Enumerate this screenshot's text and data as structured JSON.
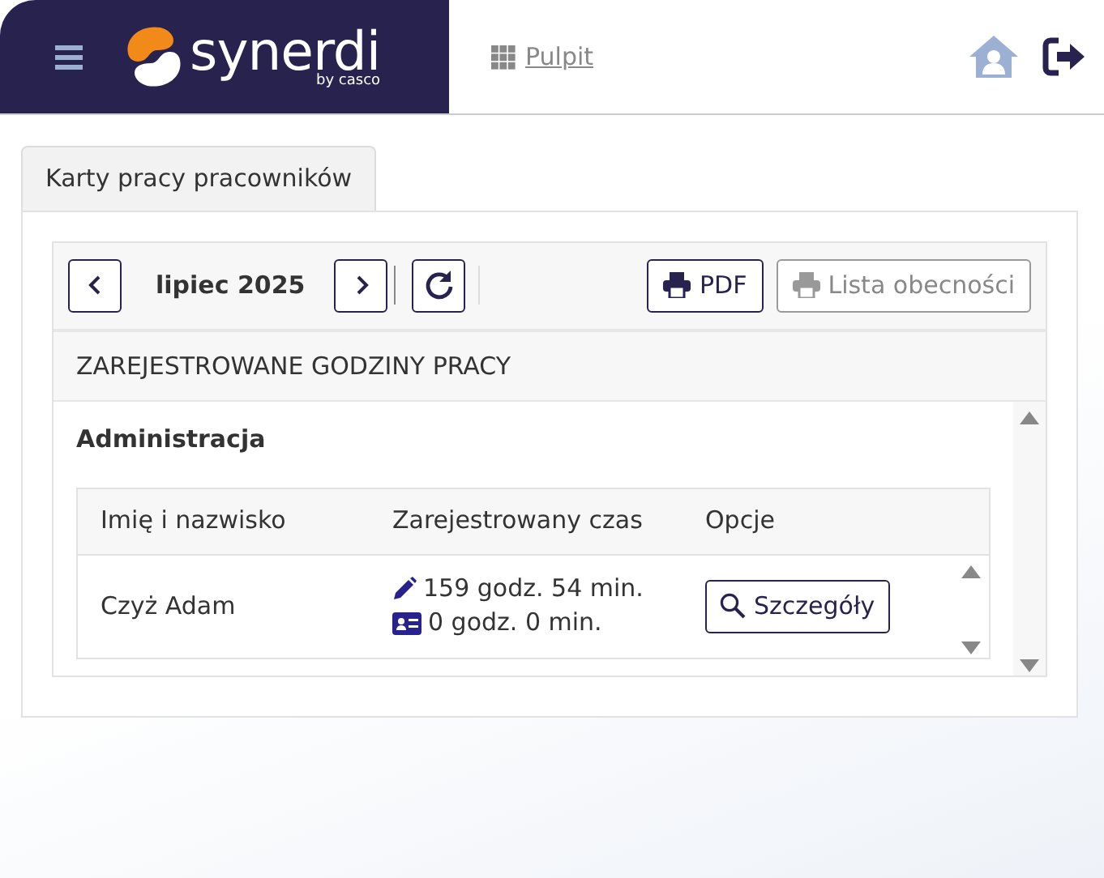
{
  "header": {
    "logo": {
      "name": "synerdi",
      "tagline": "by casco"
    },
    "nav": [
      {
        "label": "Pulpit",
        "selected": false
      }
    ]
  },
  "tabs": [
    {
      "label": "Karty pracy pracowników",
      "selected": true
    }
  ],
  "toolbar": {
    "period": "lipiec 2025",
    "buttons": [
      {
        "label": "PDF",
        "disabled": false
      },
      {
        "label": "Lista obecności",
        "disabled": true
      }
    ]
  },
  "section_title": "ZAREJESTROWANE GODZINY PRACY",
  "group": {
    "title": "Administracja"
  },
  "table": {
    "columns": [
      "Imię i nazwisko",
      "Zarejestrowany czas",
      "Opcje"
    ],
    "rows": [
      {
        "name": "Czyż Adam",
        "times": [
          {
            "kind": "edited",
            "text": "159 godz. 54 min."
          },
          {
            "kind": "card",
            "text": "0 godz. 0 min."
          }
        ],
        "action": "Szczegóły"
      }
    ]
  }
}
